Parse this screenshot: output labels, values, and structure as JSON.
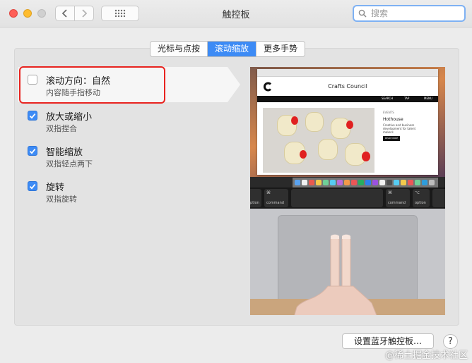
{
  "window": {
    "title": "触控板"
  },
  "search": {
    "placeholder": "搜索"
  },
  "tabs": [
    {
      "label": "光标与点按",
      "active": false
    },
    {
      "label": "滚动缩放",
      "active": true
    },
    {
      "label": "更多手势",
      "active": false
    }
  ],
  "options": [
    {
      "title": "滚动方向：自然",
      "subtitle": "内容随手指移动",
      "checked": false
    },
    {
      "title": "放大或缩小",
      "subtitle": "双指捏合",
      "checked": true
    },
    {
      "title": "智能缩放",
      "subtitle": "双指轻点两下",
      "checked": true
    },
    {
      "title": "旋转",
      "subtitle": "双指旋转",
      "checked": true
    }
  ],
  "preview": {
    "site_title": "Crafts Council",
    "menu": [
      "SEARCH",
      "TAP",
      "MENU"
    ],
    "article_caption": "EVENTS",
    "article_heading": "Hothouse",
    "article_text": "Creative and business development for talent makers",
    "article_button": "READ MORE",
    "keys": [
      {
        "symbol": "",
        "label": "option"
      },
      {
        "symbol": "⌘",
        "label": "command"
      },
      {
        "symbol": "⌘",
        "label": "command"
      },
      {
        "symbol": "⌥",
        "label": "option"
      }
    ]
  },
  "footer": {
    "bluetooth_button": "设置蓝牙触控板…",
    "help_button": "?"
  },
  "watermark": "@稀土掘金技术社区",
  "colors": {
    "accent": "#3d8bf5",
    "highlight_outline": "#e8231f"
  }
}
